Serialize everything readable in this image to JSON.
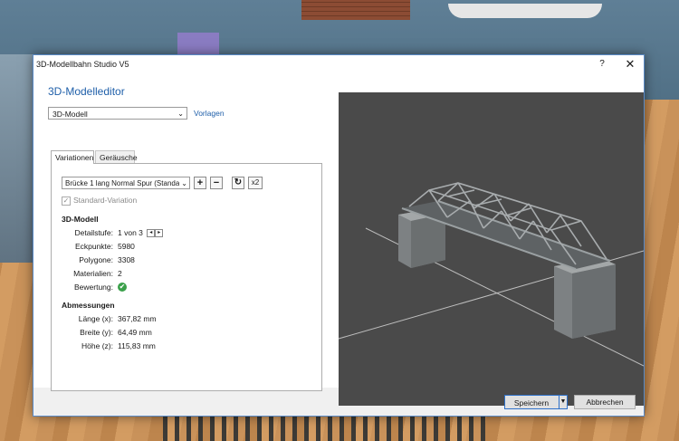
{
  "window": {
    "title": "3D-Modellbahn Studio V5",
    "help_label": "?",
    "close_label": "✕"
  },
  "editor": {
    "heading": "3D-Modelleditor",
    "type_select": "3D-Modell",
    "templates_link": "Vorlagen",
    "tabs": [
      {
        "label": "Variationen"
      },
      {
        "label": "Geräusche"
      }
    ]
  },
  "variation": {
    "selected": "Brücke 1 lang Normal Spur (Standar",
    "buttons": {
      "add": "+",
      "remove": "−",
      "refresh": "↻",
      "x2": "x2"
    },
    "standard_label": "Standard-Variation"
  },
  "model": {
    "section": "3D-Modell",
    "rows": [
      {
        "label": "Detailstufe:",
        "value": "1 von 3"
      },
      {
        "label": "Eckpunkte:",
        "value": "5980"
      },
      {
        "label": "Polygone:",
        "value": "3308"
      },
      {
        "label": "Materialien:",
        "value": "2"
      },
      {
        "label": "Bewertung:",
        "value": "✔"
      }
    ]
  },
  "dimensions": {
    "section": "Abmessungen",
    "rows": [
      {
        "label": "Länge (x):",
        "value": "367,82 mm"
      },
      {
        "label": "Breite (y):",
        "value": "64,49 mm"
      },
      {
        "label": "Höhe (z):",
        "value": "115,83 mm"
      }
    ]
  },
  "footer": {
    "save": "Speichern",
    "cancel": "Abbrechen"
  },
  "icons": {
    "close": "close-icon",
    "help": "help-icon",
    "dropdown": "chevron-down-icon",
    "ok": "check-circle-icon"
  },
  "colors": {
    "accent": "#1f5fa9",
    "viewport_bg": "#4a4a4a",
    "ok": "#3aa04a"
  }
}
